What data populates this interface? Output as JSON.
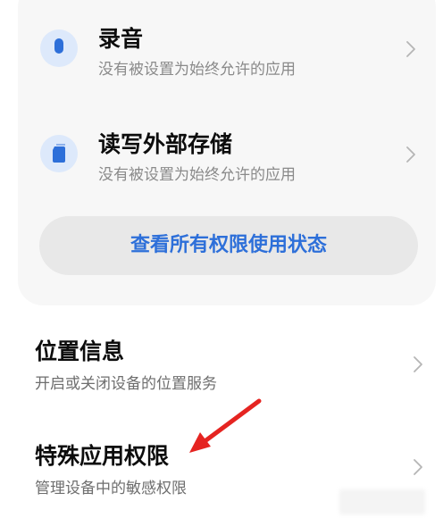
{
  "permissions": [
    {
      "title": "录音",
      "subtitle": "没有被设置为始终允许的应用",
      "icon": "microphone-icon"
    },
    {
      "title": "读写外部存储",
      "subtitle": "没有被设置为始终允许的应用",
      "icon": "storage-icon"
    }
  ],
  "view_all_button": "查看所有权限使用状态",
  "menu": [
    {
      "title": "位置信息",
      "subtitle": "开启或关闭设备的位置服务"
    },
    {
      "title": "特殊应用权限",
      "subtitle": "管理设备中的敏感权限"
    }
  ],
  "colors": {
    "accent": "#2d6fd9",
    "icon_bg": "#dde9fb",
    "card_bg": "#f7f7f7",
    "annotation_arrow": "#e52421"
  }
}
